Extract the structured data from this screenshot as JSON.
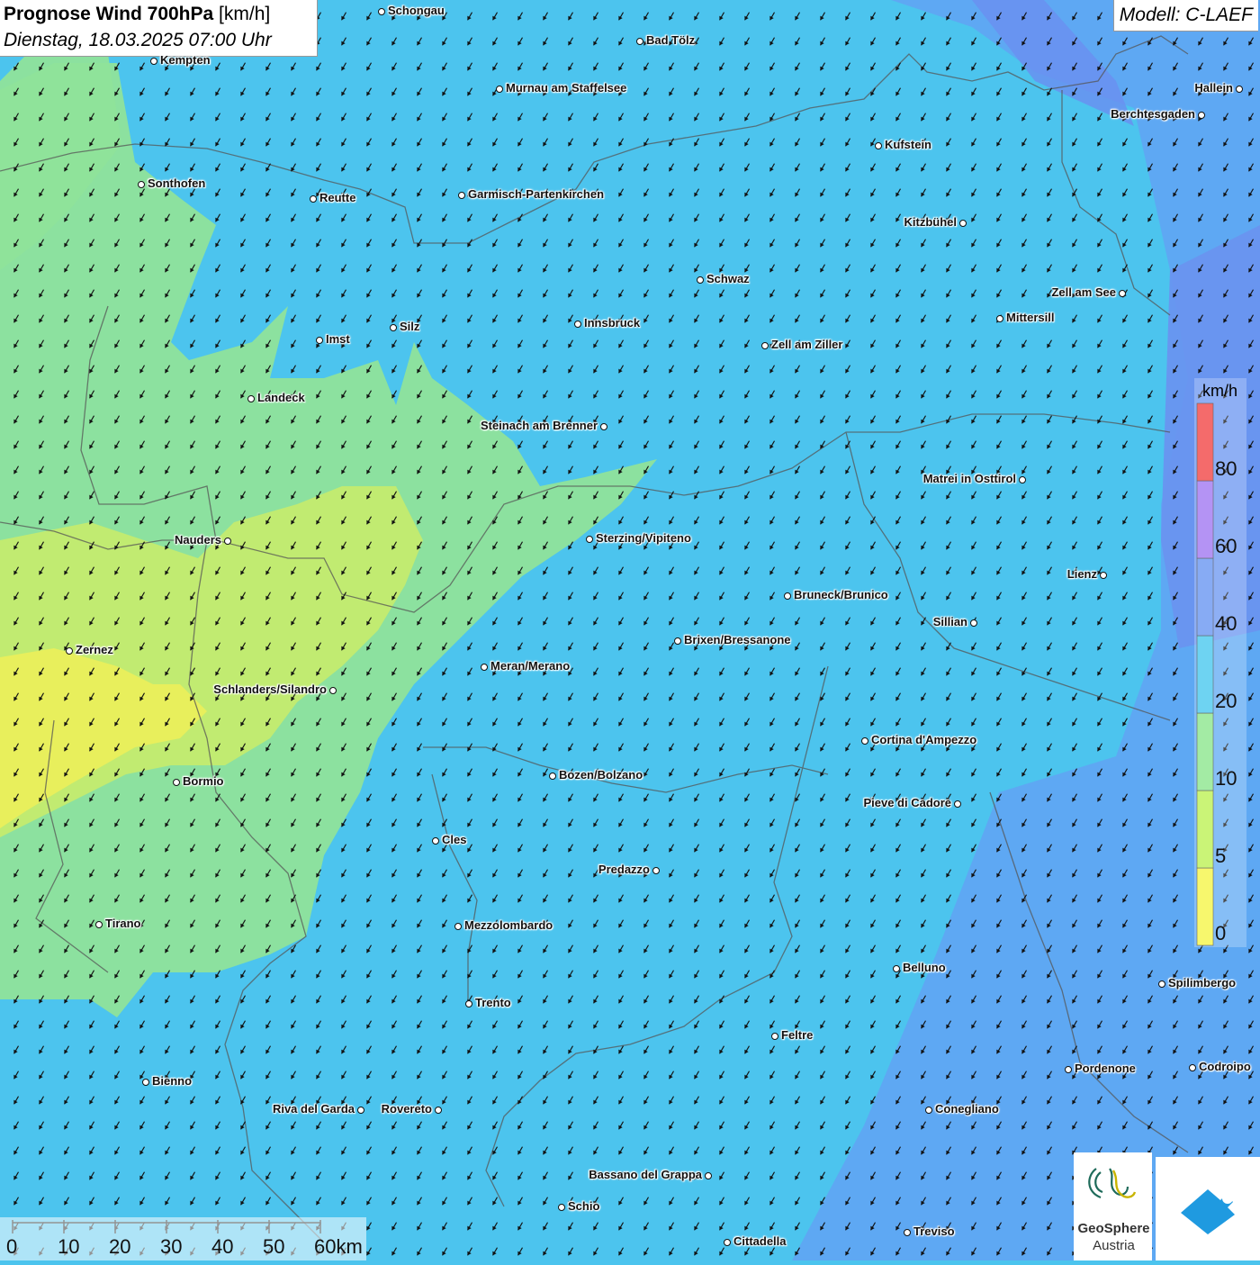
{
  "header": {
    "title_bold": "Prognose Wind 700hPa",
    "title_unit": "[km/h]",
    "datetime": "Dienstag, 18.03.2025 07:00 Uhr",
    "model": "Modell: C-LAEF"
  },
  "legend": {
    "unit": "km/h",
    "ticks": [
      "0",
      "5",
      "10",
      "20",
      "40",
      "60",
      "80"
    ],
    "colors": [
      "#f5f53c",
      "#b8f04a",
      "#84e486",
      "#3ec4ee",
      "#5f8ff0",
      "#9b6ff0",
      "#f03a3a"
    ]
  },
  "scale_bar": {
    "labels": [
      "0",
      "10",
      "20",
      "30",
      "40",
      "50",
      "60km"
    ]
  },
  "cities": [
    {
      "name": "Schongau"
    },
    {
      "name": "Kempten"
    },
    {
      "name": "Bad Tölz"
    },
    {
      "name": "Murnau am Staffelsee"
    },
    {
      "name": "Hallein"
    },
    {
      "name": "Berchtesgaden"
    },
    {
      "name": "Kufstein"
    },
    {
      "name": "Sonthofen"
    },
    {
      "name": "Reutte"
    },
    {
      "name": "Garmisch-Partenkirchen"
    },
    {
      "name": "Kitzbühel"
    },
    {
      "name": "Schwaz"
    },
    {
      "name": "Zell am See"
    },
    {
      "name": "Mittersill"
    },
    {
      "name": "Imst"
    },
    {
      "name": "Silz"
    },
    {
      "name": "Innsbruck"
    },
    {
      "name": "Zell am Ziller"
    },
    {
      "name": "Landeck"
    },
    {
      "name": "Steinach am Brenner"
    },
    {
      "name": "Matrei in Osttirol"
    },
    {
      "name": "Nauders"
    },
    {
      "name": "Sterzing/Vipiteno"
    },
    {
      "name": "Lienz"
    },
    {
      "name": "Bruneck/Brunico"
    },
    {
      "name": "Sillian"
    },
    {
      "name": "Brixen/Bressanone"
    },
    {
      "name": "Zernez"
    },
    {
      "name": "Meran/Merano"
    },
    {
      "name": "Schlanders/Silandro"
    },
    {
      "name": "Cortina d'Ampezzo"
    },
    {
      "name": "Bozen/Bolzano"
    },
    {
      "name": "Bormio"
    },
    {
      "name": "Pieve di Cadore"
    },
    {
      "name": "Cles"
    },
    {
      "name": "Predazzo"
    },
    {
      "name": "Tirano"
    },
    {
      "name": "Mezzolombardo"
    },
    {
      "name": "Belluno"
    },
    {
      "name": "Spilimbergo"
    },
    {
      "name": "Trento"
    },
    {
      "name": "Feltre"
    },
    {
      "name": "Pordenone"
    },
    {
      "name": "Codroipo"
    },
    {
      "name": "Bienno"
    },
    {
      "name": "Riva del Garda"
    },
    {
      "name": "Rovereto"
    },
    {
      "name": "Conegliano"
    },
    {
      "name": "Bassano del Grappa"
    },
    {
      "name": "Schio"
    },
    {
      "name": "Treviso"
    },
    {
      "name": "Cittadella"
    }
  ],
  "logo": {
    "line1": "GeoSphere",
    "line2": "Austria"
  }
}
